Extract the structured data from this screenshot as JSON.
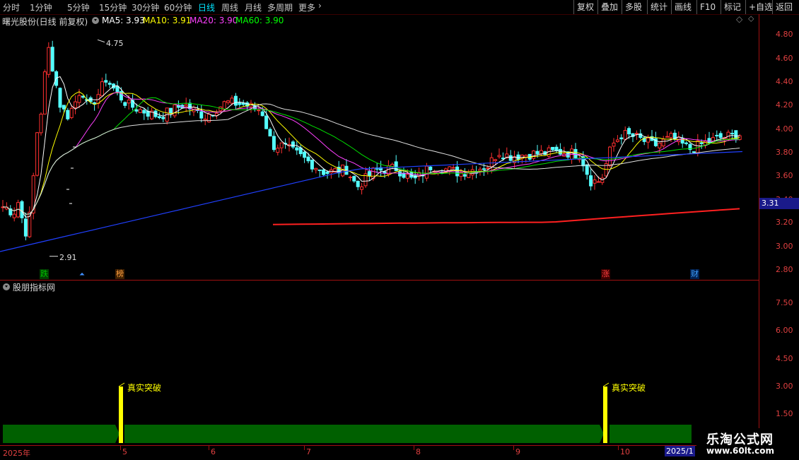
{
  "topbar": {
    "tabs": [
      "分时",
      "1分钟",
      "5分钟",
      "15分钟",
      "30分钟",
      "60分钟",
      "日线",
      "周线",
      "月线",
      "多周期",
      "更多"
    ],
    "active_tab": "日线",
    "right_buttons": [
      "复权",
      "叠加",
      "多股",
      "统计",
      "画线",
      "F10",
      "标记",
      "+自选",
      "返回"
    ]
  },
  "info": {
    "stock_title": "曙光股份(日线 前复权)",
    "ma5": "MA5: 3.93",
    "ma10": "MA10: 3.91",
    "ma20": "MA20: 3.90",
    "ma60": "MA60: 3.90",
    "colors": {
      "ma5": "#ffffff",
      "ma10": "#ffff00",
      "ma20": "#ff40ff",
      "ma60": "#00ff00"
    }
  },
  "main_axis": [
    "4.80",
    "4.60",
    "4.40",
    "4.20",
    "4.00",
    "3.80",
    "3.60",
    "3.40",
    "3.20",
    "3.00",
    "2.80"
  ],
  "current_price_tag": "3.31",
  "annotations": {
    "high": "4.75",
    "low": "2.91"
  },
  "markers": [
    {
      "text": "跌",
      "color": "#00c000",
      "bg": "#005000"
    },
    {
      "text": "榜",
      "color": "#ffa040",
      "bg": "#502000"
    },
    {
      "text": "涨",
      "color": "#ff4040",
      "bg": "#500000"
    },
    {
      "text": "财",
      "color": "#40a0ff",
      "bg": "#002050"
    }
  ],
  "sub_panel": {
    "title": "股朋指标网",
    "axis": [
      "7.50",
      "6.00",
      "4.50",
      "3.00",
      "1.50"
    ],
    "signal_label": "真实突破",
    "signals": [
      "真实突破",
      "真实突破"
    ]
  },
  "time_axis": [
    "2025年",
    "5",
    "6",
    "7",
    "8",
    "9",
    "10",
    "2025/1"
  ],
  "watermark": {
    "line1": "乐淘公式网",
    "line2": "www.60lt.com"
  }
}
